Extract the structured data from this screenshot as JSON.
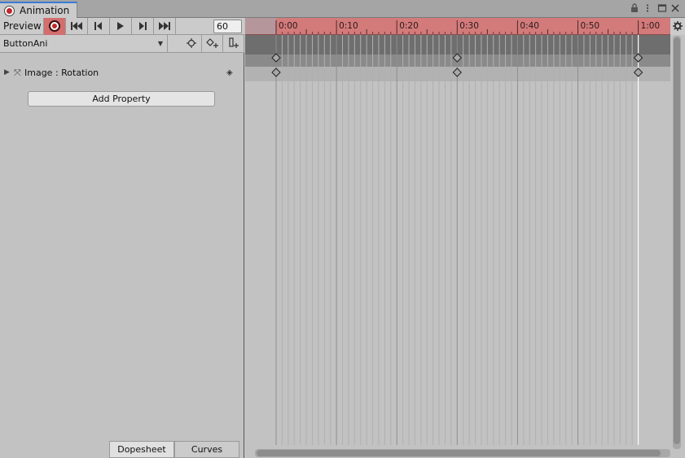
{
  "window": {
    "tab_title": "Animation",
    "tab_icon": "record-dot-icon",
    "controls": [
      "lock-icon",
      "more-icon",
      "maximize-icon",
      "close-icon"
    ]
  },
  "toolbar": {
    "preview_label": "Preview",
    "record_icon": "record-icon",
    "first_key_icon": "first-key-icon",
    "prev_key_icon": "prev-key-icon",
    "play_icon": "play-icon",
    "next_key_icon": "next-key-icon",
    "last_key_icon": "last-key-icon",
    "frame_value": "60"
  },
  "clip": {
    "selected": "ButtonAni",
    "tools": [
      "filter-by-selection-icon",
      "add-keyframe-icon",
      "add-event-icon"
    ]
  },
  "properties": [
    {
      "label": "Image : Rotation",
      "icon": "rect-transform-icon",
      "key_icon": "keyframe-diamond-icon"
    }
  ],
  "add_property_label": "Add Property",
  "bottom_tabs": [
    "Dopesheet",
    "Curves"
  ],
  "active_bottom_tab": "Dopesheet",
  "timeline": {
    "ruler_labels": [
      "0:00",
      "0:10",
      "0:20",
      "0:30",
      "0:40",
      "0:50",
      "1:00"
    ],
    "playhead_label": "1:00",
    "keyframe_times": [
      "0:00",
      "0:30",
      "1:00"
    ],
    "colors": {
      "ruler_record": "#d37a7a",
      "summary_row": "#6e6e6e",
      "record_red": "#c0262c",
      "tab_accent": "#3a7bd5"
    }
  }
}
